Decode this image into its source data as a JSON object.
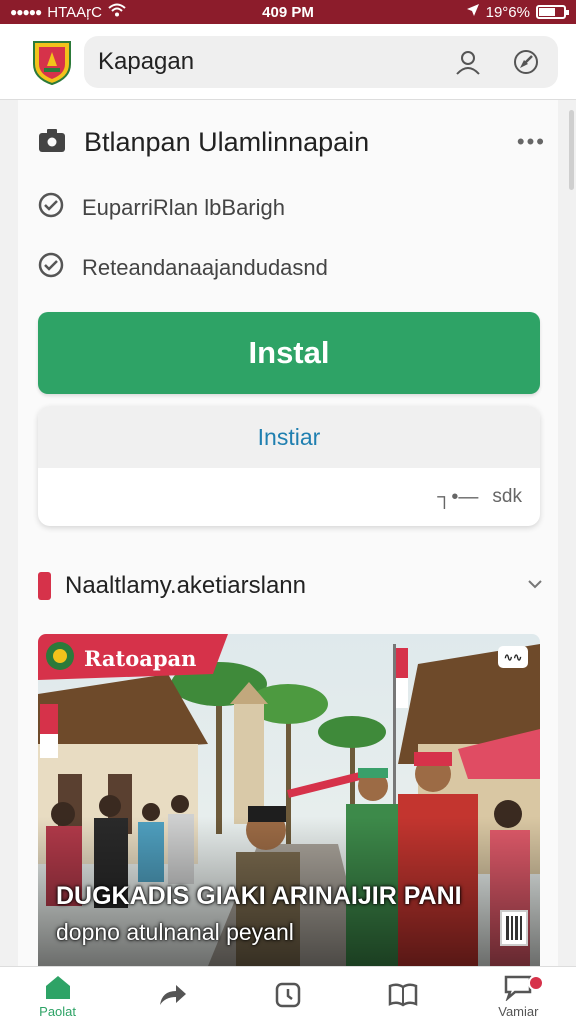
{
  "status_bar": {
    "carrier": "HTAAŗC",
    "time": "409 PM",
    "battery": "19°6%"
  },
  "app_bar": {
    "search_text": "Kapagan",
    "logo_icon": "regional-crest-logo",
    "profile_icon": "user-icon",
    "settings_icon": "compass-icon"
  },
  "info": {
    "title": "Btlanpan Ulamlinnapain",
    "items": [
      {
        "label": "EuparriRlan lbBarigh"
      },
      {
        "label": "Reteandanaajandudasnd"
      }
    ]
  },
  "install_button": "Instal",
  "card": {
    "title": "Instiar",
    "footer_symbol": "┐•—",
    "footer_label": "sdk"
  },
  "section": {
    "title": "Naaltlamy.aketiarslann"
  },
  "hero": {
    "banner_label": "Ratoapan",
    "badge": "∿∿",
    "headline": "DUGKADIS GIAKI ARINAIJIR PANI",
    "subtitle": "dopno atulnanal peyanl"
  },
  "bottom_nav": [
    {
      "label": "Paolat",
      "icon": "home-icon"
    },
    {
      "label": "",
      "icon": "share-icon"
    },
    {
      "label": "",
      "icon": "clock-icon"
    },
    {
      "label": "",
      "icon": "book-icon"
    },
    {
      "label": "Vamiar",
      "icon": "chat-icon"
    }
  ],
  "colors": {
    "status_bar": "#8c1c2b",
    "primary": "#2ea366",
    "link": "#1f7fb0",
    "accent": "#d6324a"
  }
}
